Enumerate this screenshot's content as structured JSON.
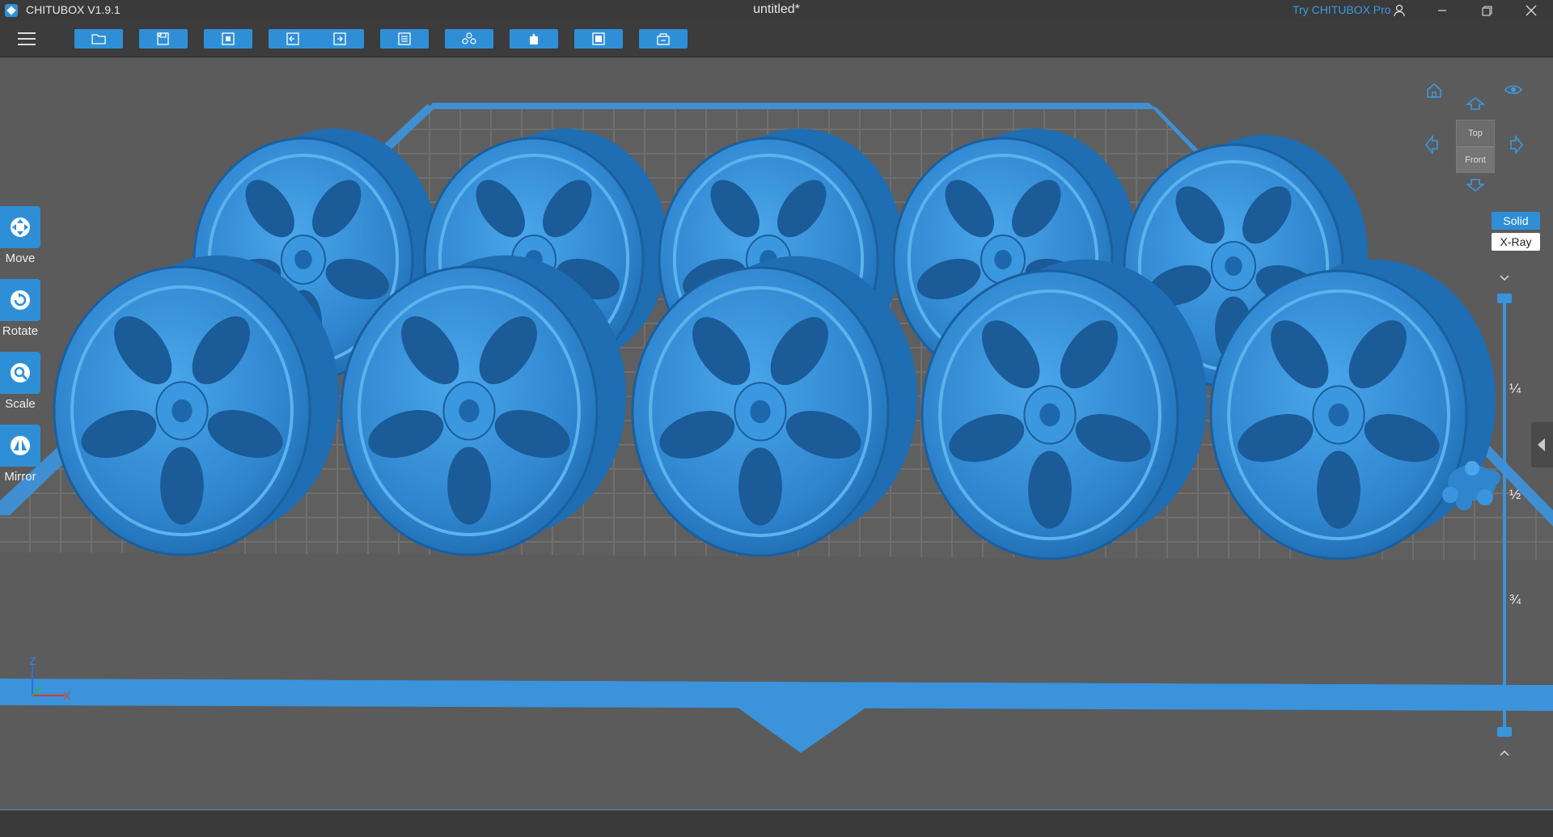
{
  "window": {
    "app_name": "CHITUBOX V1.9.1",
    "doc_title": "untitled*",
    "try_pro": "Try CHITUBOX Pro"
  },
  "toolbar": {
    "buttons": [
      {
        "icon": "open-file-icon"
      },
      {
        "icon": "save-icon",
        "dropdown": true
      },
      {
        "icon": "select-all-icon"
      },
      {
        "icon": "undo-icon"
      },
      {
        "icon": "redo-icon"
      },
      {
        "icon": "settings-list-icon"
      },
      {
        "icon": "supports-icon"
      },
      {
        "icon": "hollow-icon"
      },
      {
        "icon": "slice-icon"
      },
      {
        "icon": "print-icon"
      }
    ]
  },
  "tools": {
    "move": "Move",
    "rotate": "Rotate",
    "scale": "Scale",
    "mirror": "Mirror"
  },
  "view": {
    "cube_top": "Top",
    "cube_front": "Front",
    "solid": "Solid",
    "xray": "X-Ray",
    "active_mode": "Solid"
  },
  "slice_slider": {
    "marks": [
      "¼",
      "½",
      "¾"
    ],
    "upper_value": 1.0,
    "lower_value": 0.0
  },
  "axes": {
    "z": "Z",
    "x": "X"
  },
  "colors": {
    "accent": "#2f8fd6",
    "model": "#2f86cf",
    "background": "#5b5b5b",
    "plate": "#606060",
    "grid": "#6e6e6e"
  },
  "scene": {
    "model_name": "car wheel rims",
    "wheel_count": 10,
    "accessory": "lug nut set"
  }
}
